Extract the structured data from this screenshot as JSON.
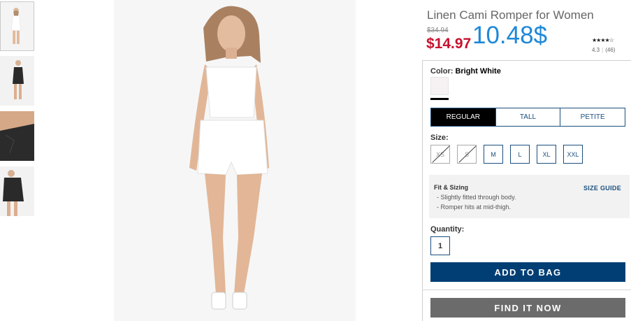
{
  "product": {
    "title": "Linen Cami Romper for Women",
    "original_price": "$34.94",
    "sale_price": "$14.97",
    "highlight_price": "10.48$",
    "stars": "★★★★☆",
    "rating_value": "4.3",
    "review_count": "(46)"
  },
  "color": {
    "label": "Color:",
    "value": "Bright White",
    "swatch_color": "#f6f2f4"
  },
  "fit_tabs": [
    {
      "label": "REGULAR",
      "active": true
    },
    {
      "label": "TALL",
      "active": false
    },
    {
      "label": "PETITE",
      "active": false
    }
  ],
  "size": {
    "label": "Size:",
    "options": [
      {
        "label": "XS",
        "available": false
      },
      {
        "label": "S",
        "available": false
      },
      {
        "label": "M",
        "available": true
      },
      {
        "label": "L",
        "available": true
      },
      {
        "label": "XL",
        "available": true
      },
      {
        "label": "XXL",
        "available": true
      }
    ]
  },
  "fit_sizing": {
    "title": "Fit & Sizing",
    "lines": [
      "- Slightly fitted through body.",
      "- Romper hits at mid-thigh."
    ],
    "guide_link": "SIZE GUIDE"
  },
  "quantity": {
    "label": "Quantity:",
    "value": "1"
  },
  "buttons": {
    "add_to_bag": "ADD TO BAG",
    "find_it_now": "FIND IT NOW"
  },
  "colors": {
    "accent_blue": "#003e73",
    "sale_red": "#c8102e",
    "highlight_blue": "#1e88d8",
    "find_gray": "#6b6b6b"
  },
  "thumbnails": [
    {
      "variant": "white-romper-front",
      "active": true
    },
    {
      "variant": "black-romper-front",
      "active": false
    },
    {
      "variant": "black-romper-detail",
      "active": false
    },
    {
      "variant": "black-romper-side",
      "active": false
    }
  ]
}
